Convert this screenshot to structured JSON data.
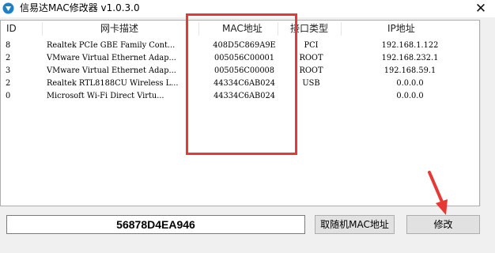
{
  "window": {
    "title": "信易达MAC修改器 v1.0.3.0",
    "close_glyph": "✕",
    "icon": "app-logo-icon"
  },
  "table": {
    "columns": [
      "ID",
      "网卡描述",
      "MAC地址",
      "接口类型",
      "IP地址"
    ],
    "rows": [
      {
        "id": "8",
        "name": "Realtek PCIe GBE Family Cont...",
        "mac": "408D5C869A9E",
        "type": "PCI",
        "ip": "192.168.1.122"
      },
      {
        "id": "2",
        "name": "VMware Virtual Ethernet Adap...",
        "mac": "005056C00001",
        "type": "ROOT",
        "ip": "192.168.232.1"
      },
      {
        "id": "3",
        "name": "VMware Virtual Ethernet Adap...",
        "mac": "005056C00008",
        "type": "ROOT",
        "ip": "192.168.59.1"
      },
      {
        "id": "2",
        "name": "Realtek RTL8188CU Wireless L...",
        "mac": "44334C6AB024",
        "type": "USB",
        "ip": "0.0.0.0"
      },
      {
        "id": "0",
        "name": "Microsoft Wi-Fi Direct Virtu...",
        "mac": "44334C6AB024",
        "type": "",
        "ip": "0.0.0.0"
      }
    ]
  },
  "mac_input": {
    "value": "56878D4EA946"
  },
  "buttons": {
    "random": "取随机MAC地址",
    "modify": "修改"
  },
  "colors": {
    "annotation": "#e53935",
    "title_icon": "#1f7fc4"
  }
}
